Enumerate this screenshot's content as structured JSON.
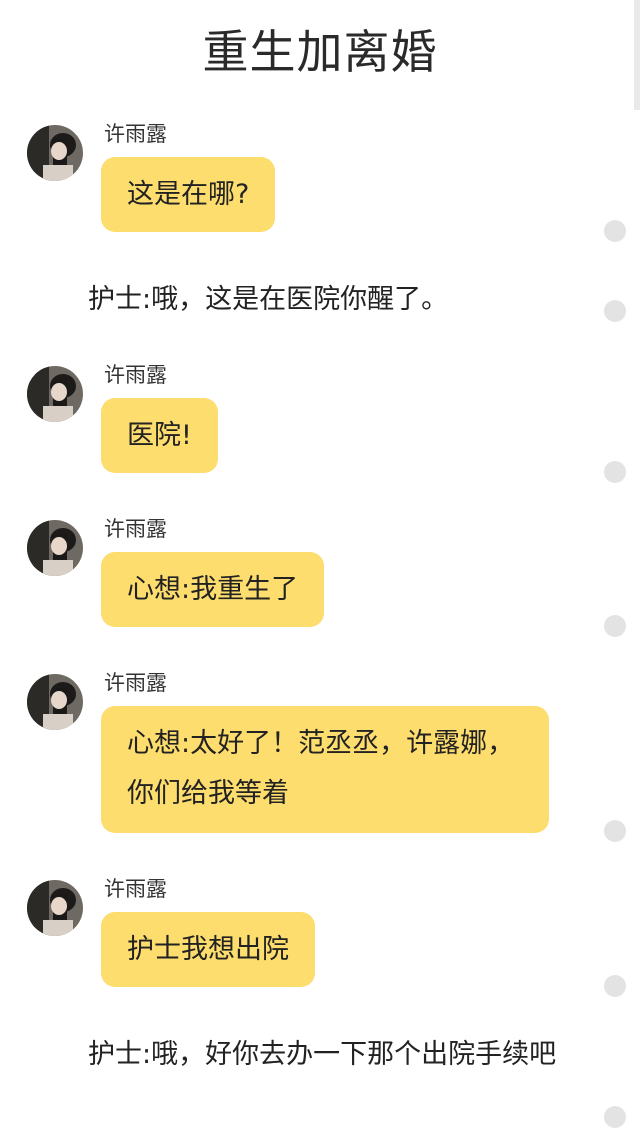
{
  "page": {
    "title": "重生加离婚"
  },
  "messages": [
    {
      "type": "chat",
      "sender": "许雨露",
      "text": "这是在哪?"
    },
    {
      "type": "narration",
      "text": "护士:哦，这是在医院你醒了。"
    },
    {
      "type": "chat",
      "sender": "许雨露",
      "text": "医院!"
    },
    {
      "type": "chat",
      "sender": "许雨露",
      "text": "心想:我重生了"
    },
    {
      "type": "chat",
      "sender": "许雨露",
      "text": "心想:太好了！范丞丞，许露娜，你们给我等着"
    },
    {
      "type": "chat",
      "sender": "许雨露",
      "text": "护士我想出院"
    },
    {
      "type": "narration",
      "text": "护士:哦，好你去办一下那个出院手续吧"
    }
  ],
  "colors": {
    "bubble": "#fddd6d",
    "background": "#ffffff",
    "dot": "#e3e3e3"
  }
}
